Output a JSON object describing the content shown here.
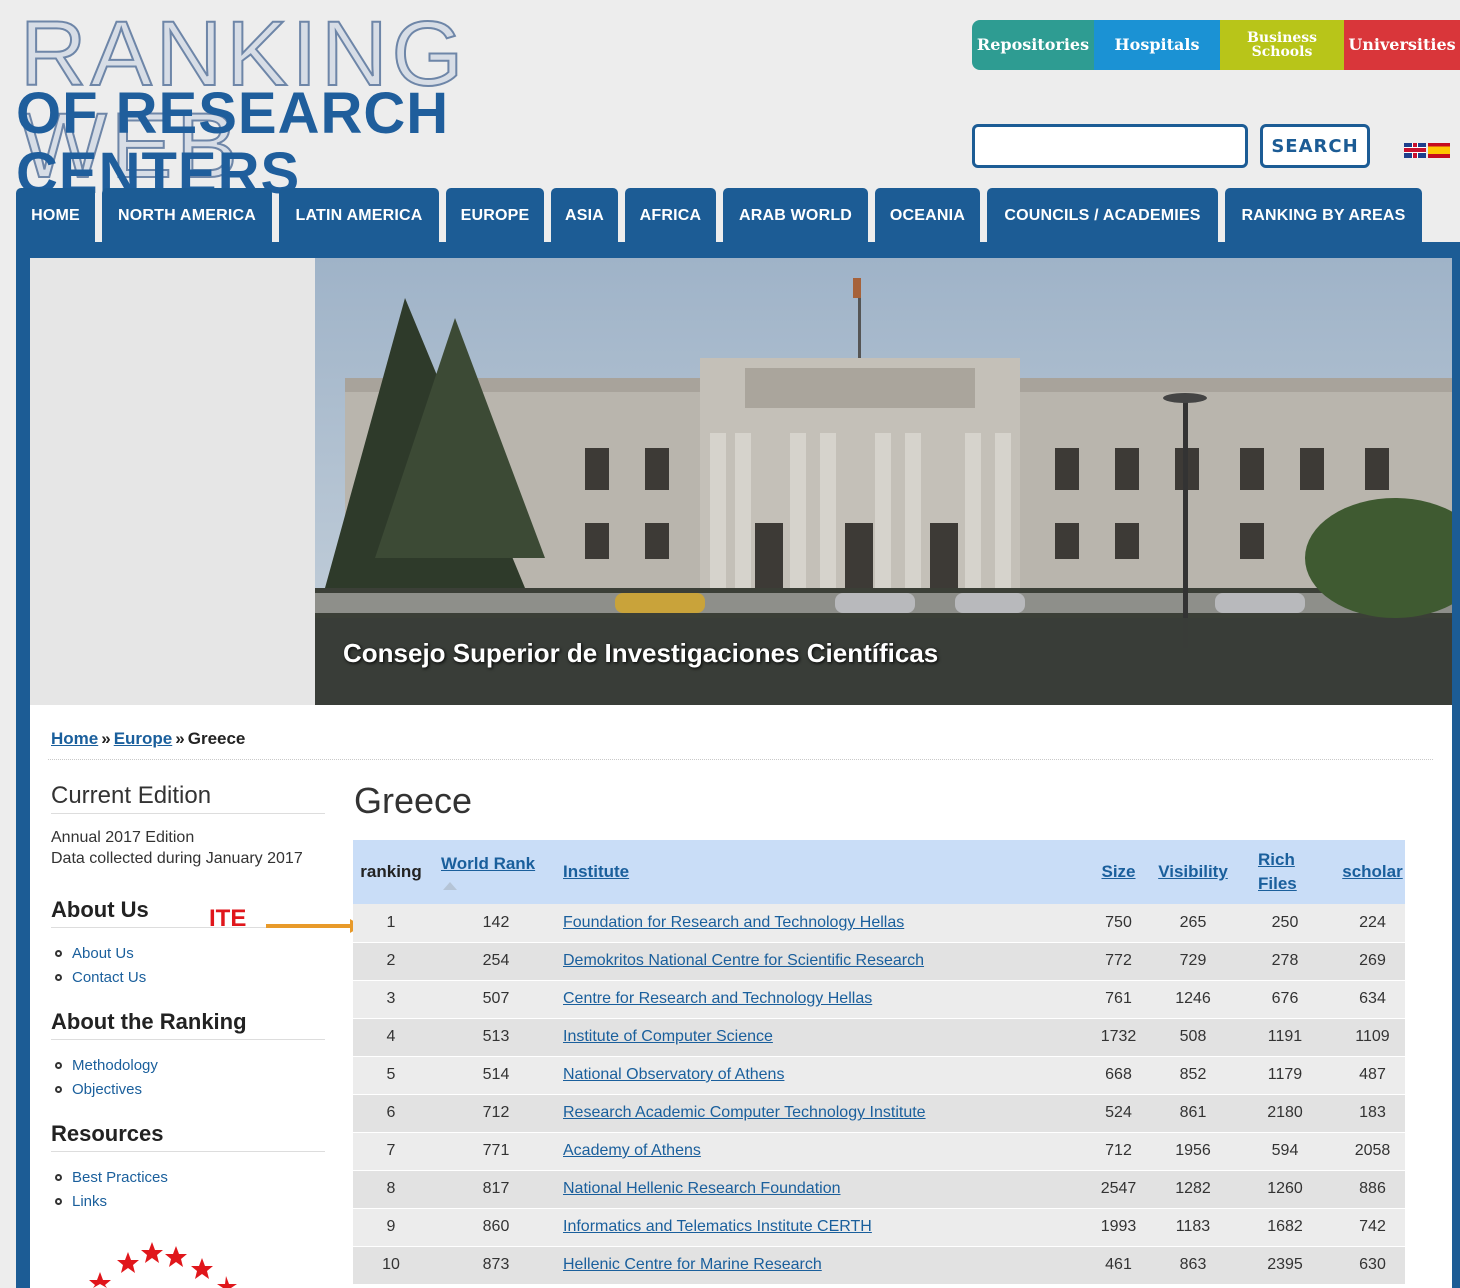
{
  "header": {
    "logo_line1": "RANKING WEB",
    "logo_line2": "OF RESEARCH CENTERS",
    "top_tabs": [
      {
        "label": "Repositories",
        "color": "#2e9c92"
      },
      {
        "label": "Hospitals",
        "color": "#1b92d4"
      },
      {
        "label": "Business Schools",
        "color": "#b8c519"
      },
      {
        "label": "Universities",
        "color": "#d9363a"
      }
    ],
    "search_button": "SEARCH",
    "search_value": ""
  },
  "nav": [
    "HOME",
    "NORTH AMERICA",
    "LATIN AMERICA",
    "EUROPE",
    "ASIA",
    "AFRICA",
    "ARAB WORLD",
    "OCEANIA",
    "COUNCILS / ACADEMIES",
    "RANKING BY AREAS"
  ],
  "banner": {
    "caption": "Consejo Superior de Investigaciones Científicas"
  },
  "breadcrumb": {
    "home": "Home",
    "sep1": "»",
    "europe": "Europe",
    "sep2": "»",
    "current": "Greece"
  },
  "sidebar": {
    "current_edition_heading": "Current Edition",
    "edition_line1": "Annual 2017 Edition",
    "edition_line2": "Data collected during January 2017",
    "about_us_heading": "About Us",
    "about_us_links": [
      "About Us",
      "Contact Us"
    ],
    "about_ranking_heading": "About the Ranking",
    "about_ranking_links": [
      "Methodology",
      "Objectives"
    ],
    "resources_heading": "Resources",
    "resources_links": [
      "Best Practices",
      "Links"
    ]
  },
  "annotation": {
    "label": "ITE",
    "color": "#e0161b"
  },
  "main": {
    "title": "Greece",
    "columns": {
      "ranking": "ranking",
      "world_rank": "World Rank",
      "institute": "Institute",
      "size": "Size",
      "visibility": "Visibility",
      "rich_files_1": "Rich",
      "rich_files_2": "Files",
      "scholar": "scholar"
    },
    "rows": [
      {
        "ranking": "1",
        "world_rank": "142",
        "institute": "Foundation for Research and Technology Hellas",
        "size": "750",
        "visibility": "265",
        "rich_files": "250",
        "scholar": "224"
      },
      {
        "ranking": "2",
        "world_rank": "254",
        "institute": "Demokritos National Centre for Scientific Research",
        "size": "772",
        "visibility": "729",
        "rich_files": "278",
        "scholar": "269"
      },
      {
        "ranking": "3",
        "world_rank": "507",
        "institute": "Centre for Research and Technology Hellas",
        "size": "761",
        "visibility": "1246",
        "rich_files": "676",
        "scholar": "634"
      },
      {
        "ranking": "4",
        "world_rank": "513",
        "institute": "Institute of Computer Science",
        "size": "1732",
        "visibility": "508",
        "rich_files": "1191",
        "scholar": "1109"
      },
      {
        "ranking": "5",
        "world_rank": "514",
        "institute": "National Observatory of Athens",
        "size": "668",
        "visibility": "852",
        "rich_files": "1179",
        "scholar": "487"
      },
      {
        "ranking": "6",
        "world_rank": "712",
        "institute": "Research Academic Computer Technology Institute",
        "size": "524",
        "visibility": "861",
        "rich_files": "2180",
        "scholar": "183"
      },
      {
        "ranking": "7",
        "world_rank": "771",
        "institute": "Academy of Athens",
        "size": "712",
        "visibility": "1956",
        "rich_files": "594",
        "scholar": "2058"
      },
      {
        "ranking": "8",
        "world_rank": "817",
        "institute": "National Hellenic Research Foundation",
        "size": "2547",
        "visibility": "1282",
        "rich_files": "1260",
        "scholar": "886"
      },
      {
        "ranking": "9",
        "world_rank": "860",
        "institute": "Informatics and Telematics Institute CERTH",
        "size": "1993",
        "visibility": "1183",
        "rich_files": "1682",
        "scholar": "742"
      },
      {
        "ranking": "10",
        "world_rank": "873",
        "institute": "Hellenic Centre for Marine Research",
        "size": "461",
        "visibility": "863",
        "rich_files": "2395",
        "scholar": "630"
      }
    ]
  }
}
